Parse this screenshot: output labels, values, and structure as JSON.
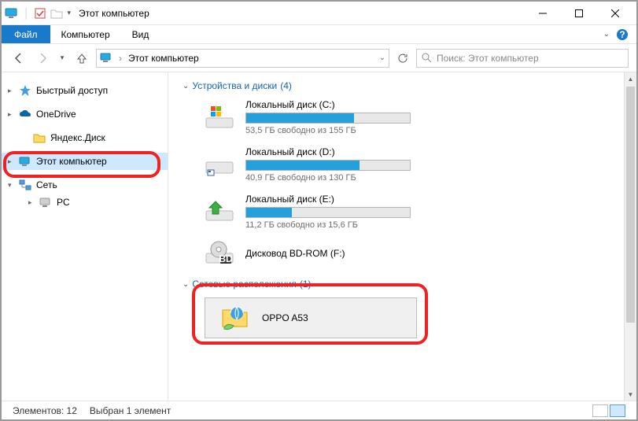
{
  "title": "Этот компьютер",
  "ribbon": {
    "file": "Файл",
    "tabs": [
      "Компьютер",
      "Вид"
    ]
  },
  "address": {
    "location": "Этот компьютер"
  },
  "search": {
    "placeholder": "Поиск: Этот компьютер"
  },
  "sidebar": {
    "items": [
      {
        "label": "Быстрый доступ",
        "icon": "star",
        "expandable": true
      },
      {
        "label": "OneDrive",
        "icon": "onedrive",
        "expandable": true
      },
      {
        "label": "Яндекс.Диск",
        "icon": "yandex",
        "expandable": false
      },
      {
        "label": "Этот компьютер",
        "icon": "pc",
        "expandable": true,
        "selected": true
      },
      {
        "label": "Сеть",
        "icon": "net",
        "expandable": true,
        "expanded": true
      },
      {
        "label": "PC",
        "icon": "pcnode",
        "expandable": true,
        "child": true
      }
    ]
  },
  "sections": {
    "devices": {
      "title": "Устройства и диски",
      "count": "(4)"
    },
    "network": {
      "title": "Сетевые расположения",
      "count": "(1)"
    }
  },
  "drives": [
    {
      "name": "Локальный диск (C:)",
      "sub": "53,5 ГБ свободно из 155 ГБ",
      "pct": 66,
      "icon": "win"
    },
    {
      "name": "Локальный диск (D:)",
      "sub": "40,9 ГБ свободно из 130 ГБ",
      "pct": 69,
      "icon": "hdd"
    },
    {
      "name": "Локальный диск (E:)",
      "sub": "11,2 ГБ свободно из 15,6 ГБ",
      "pct": 28,
      "icon": "ext"
    },
    {
      "name": "Дисковод BD-ROM (F:)",
      "sub": "",
      "pct": null,
      "icon": "bd"
    }
  ],
  "netloc": {
    "name": "OPPO A53"
  },
  "status": {
    "count": "Элементов: 12",
    "selected": "Выбран 1 элемент"
  }
}
